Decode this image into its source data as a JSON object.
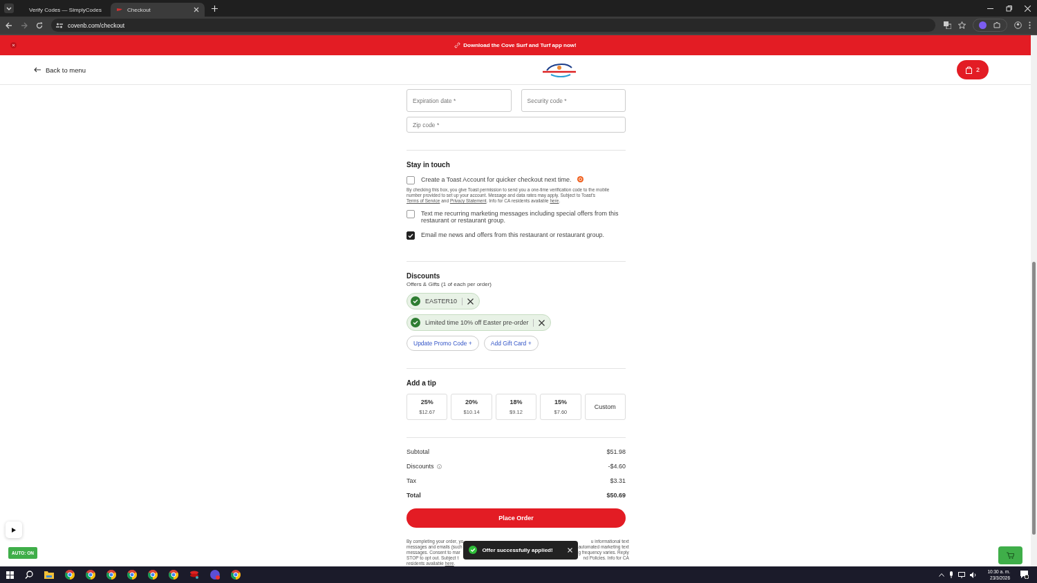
{
  "browser": {
    "tabs": [
      {
        "title": "Verify Codes — SimplyCodes",
        "selected": false
      },
      {
        "title": "Checkout",
        "selected": true
      }
    ],
    "url": "covenb.com/checkout"
  },
  "banner": {
    "text": "Download the Cove Surf and Turf app now!"
  },
  "header": {
    "back_label": "Back to menu",
    "cart_count": "2"
  },
  "payment_fields": [
    {
      "placeholder": "Expiration date *"
    },
    {
      "placeholder": "Security code *"
    },
    {
      "placeholder": "Zip code *"
    }
  ],
  "stay_in_touch": {
    "title": "Stay in touch",
    "options": [
      {
        "label": "Create a Toast Account for quicker checkout next time.",
        "checked": false,
        "note": [
          {
            "text": "By checking this box, you give Toast permission to send you a one-time verification code to the mobile number provided to set up your account. Message and data rates may apply. Subject to Toast's ",
            "kind": "text"
          },
          {
            "text": "Terms of Service",
            "kind": "link"
          },
          {
            "text": " and ",
            "kind": "text"
          },
          {
            "text": "Privacy Statement",
            "kind": "link"
          },
          {
            "text": ". Info for CA residents available ",
            "kind": "text"
          },
          {
            "text": "here",
            "kind": "link"
          },
          {
            "text": ".",
            "kind": "text"
          }
        ]
      },
      {
        "label": "Text me recurring marketing messages including special offers from this restaurant or restaurant group.",
        "checked": false
      },
      {
        "label": "Email me news and offers from this restaurant or restaurant group.",
        "checked": true
      }
    ]
  },
  "discounts": {
    "title": "Discounts",
    "subtitle": "Offers & Gifts (1 of each per order)",
    "applied": [
      {
        "label": "EASTER10"
      },
      {
        "label": "Limited time 10% off Easter pre-order"
      }
    ],
    "buttons": [
      "Update Promo Code +",
      "Add Gift Card +"
    ]
  },
  "tip": {
    "title": "Add a tip",
    "options": [
      {
        "kind": "percent",
        "percent": "25%",
        "amount": "$12.67",
        "selected": false
      },
      {
        "kind": "percent",
        "percent": "20%",
        "amount": "$10.14",
        "selected": false
      },
      {
        "kind": "percent",
        "percent": "18%",
        "amount": "$9.12",
        "selected": false
      },
      {
        "kind": "percent",
        "percent": "15%",
        "amount": "$7.60",
        "selected": false
      },
      {
        "kind": "custom",
        "percent": "Custom",
        "selected": false
      }
    ]
  },
  "summary": [
    {
      "label": "Subtotal",
      "value": "$51.98",
      "kind": "line"
    },
    {
      "label": "Discounts",
      "value": "-$4.60",
      "kind": "info"
    },
    {
      "label": "Tax",
      "value": "$3.31",
      "kind": "line"
    },
    {
      "label": "Total",
      "value": "$50.69",
      "kind": "total"
    }
  ],
  "place_order": "Place Order",
  "legal": [
    {
      "left": "By completing your order, yo",
      "right": "u informational text"
    },
    {
      "left": "messages and emails (such",
      "right": "automated marketing text"
    },
    {
      "left": "messages. Consent to mar",
      "right": "g frequency varies. Reply"
    },
    {
      "left": "STOP to opt out. Subject t",
      "right": "nd Policies. Info for CA"
    },
    {
      "left": "residents available ",
      "link": "here",
      "tail": "."
    }
  ],
  "toast": "Offer successfully applied!",
  "auto_button": "AUTO: ON",
  "taskbar": {
    "time": "10:30 a. m.",
    "date": "23/3/2026"
  }
}
